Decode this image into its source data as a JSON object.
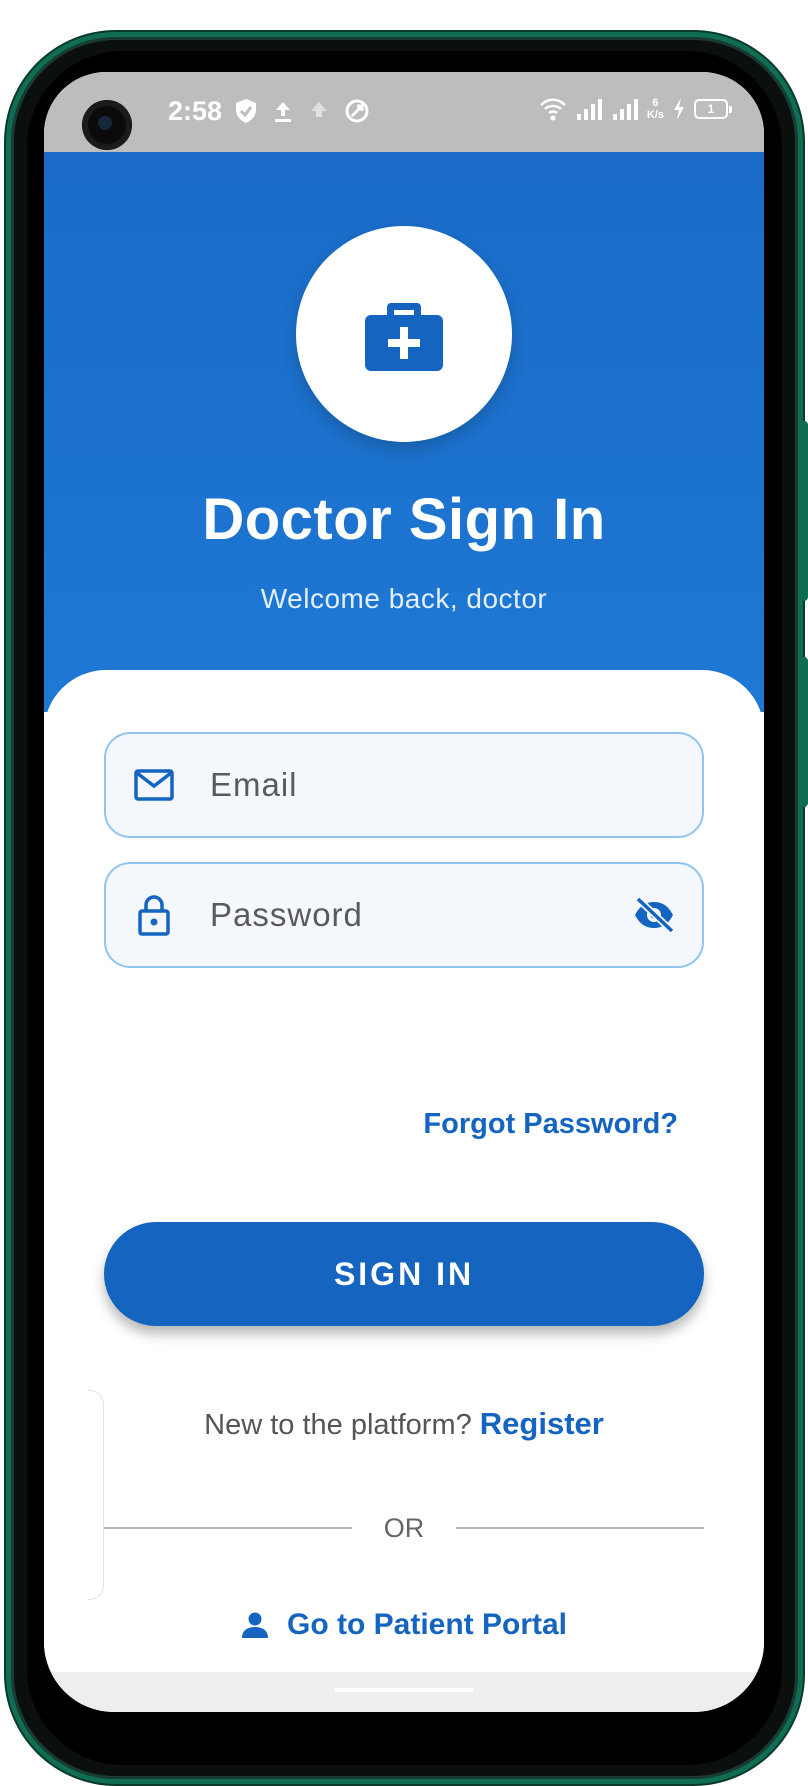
{
  "status_bar": {
    "time": "2:58",
    "network_speed_value": "6",
    "network_speed_unit": "K/s",
    "battery_level": "1",
    "icons": [
      "shield-check-icon",
      "upload-icon",
      "upload-icon",
      "sync-icon",
      "wifi-icon",
      "signal-icon",
      "signal-icon",
      "charging-icon",
      "battery-icon"
    ]
  },
  "header": {
    "logo_icon": "medical-bag-icon",
    "title": "Doctor Sign In",
    "subtitle": "Welcome back, doctor"
  },
  "form": {
    "email_placeholder": "Email",
    "email_icon": "mail-icon",
    "password_placeholder": "Password",
    "password_icon": "lock-icon",
    "visibility_icon": "eye-off-icon",
    "forgot_password": "Forgot Password?",
    "sign_in_label": "SIGN IN"
  },
  "register": {
    "prompt": "New to the platform?",
    "link": "Register"
  },
  "divider": {
    "label": "OR"
  },
  "patient_portal": {
    "icon": "person-icon",
    "label": "Go to Patient Portal"
  },
  "colors": {
    "primary": "#1565c0",
    "header_blue": "#1e78d4",
    "field_border": "#90c4ee",
    "field_bg": "#f4f8fc",
    "frame_green": "#0e6d52"
  }
}
